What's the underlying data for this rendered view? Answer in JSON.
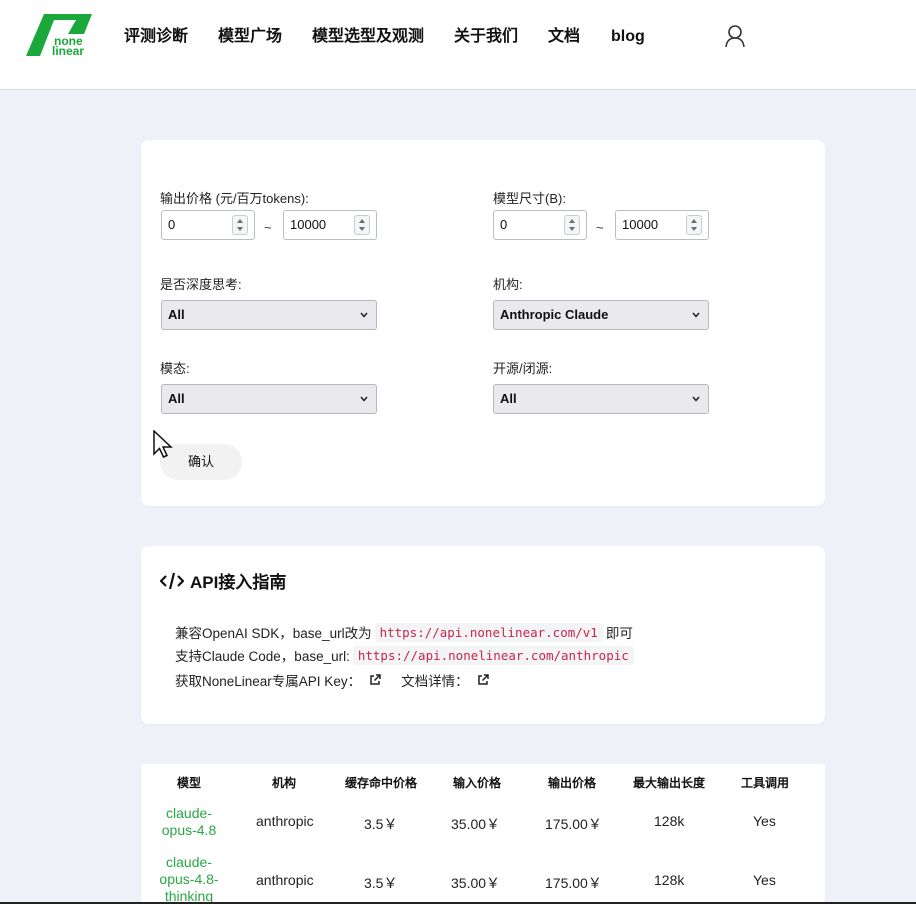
{
  "header": {
    "logo_text_top": "none",
    "logo_text_bottom": "linear",
    "nav": [
      {
        "label": "评测诊断"
      },
      {
        "label": "模型广场"
      },
      {
        "label": "模型选型及观测"
      },
      {
        "label": "关于我们"
      },
      {
        "label": "文档"
      },
      {
        "label": "blog"
      }
    ]
  },
  "filters": {
    "output_price": {
      "label": "输出价格 (元/百万tokens):",
      "min": "0",
      "max": "10000"
    },
    "model_size": {
      "label": "模型尺寸(B):",
      "min": "0",
      "max": "10000"
    },
    "deep_thinking": {
      "label": "是否深度思考:",
      "value": "All"
    },
    "org": {
      "label": "机构:",
      "value": "Anthropic Claude"
    },
    "modality": {
      "label": "模态:",
      "value": "All"
    },
    "open_source": {
      "label": "开源/闭源:",
      "value": "All"
    },
    "tilde": "~",
    "confirm_label": "确认"
  },
  "api": {
    "title": "API接入指南",
    "line1_prefix": "兼容OpenAI SDK，base_url改为",
    "line1_code": "https://api.nonelinear.com/v1",
    "line1_suffix": "即可",
    "line2_prefix": "支持Claude Code，base_url:",
    "line2_code": "https://api.nonelinear.com/anthropic",
    "line3_key": "获取NoneLinear专属API Key：",
    "line3_docs": "文档详情："
  },
  "table": {
    "headers": [
      "模型",
      "机构",
      "缓存命中价格",
      "输入价格",
      "输出价格",
      "最大输出长度",
      "工具调用"
    ],
    "rows": [
      {
        "model": "claude-opus-4.8",
        "org": "anthropic",
        "cache": "3.5￥",
        "input": "35.00￥",
        "output": "175.00￥",
        "max_len": "128k",
        "tools": "Yes"
      },
      {
        "model": "claude-opus-4.8-thinking",
        "org": "anthropic",
        "cache": "3.5￥",
        "input": "35.00￥",
        "output": "175.00￥",
        "max_len": "128k",
        "tools": "Yes"
      }
    ]
  },
  "colors": {
    "brand_green": "#1aa83a",
    "link_green": "#28a745",
    "code_red": "#c7254e"
  }
}
